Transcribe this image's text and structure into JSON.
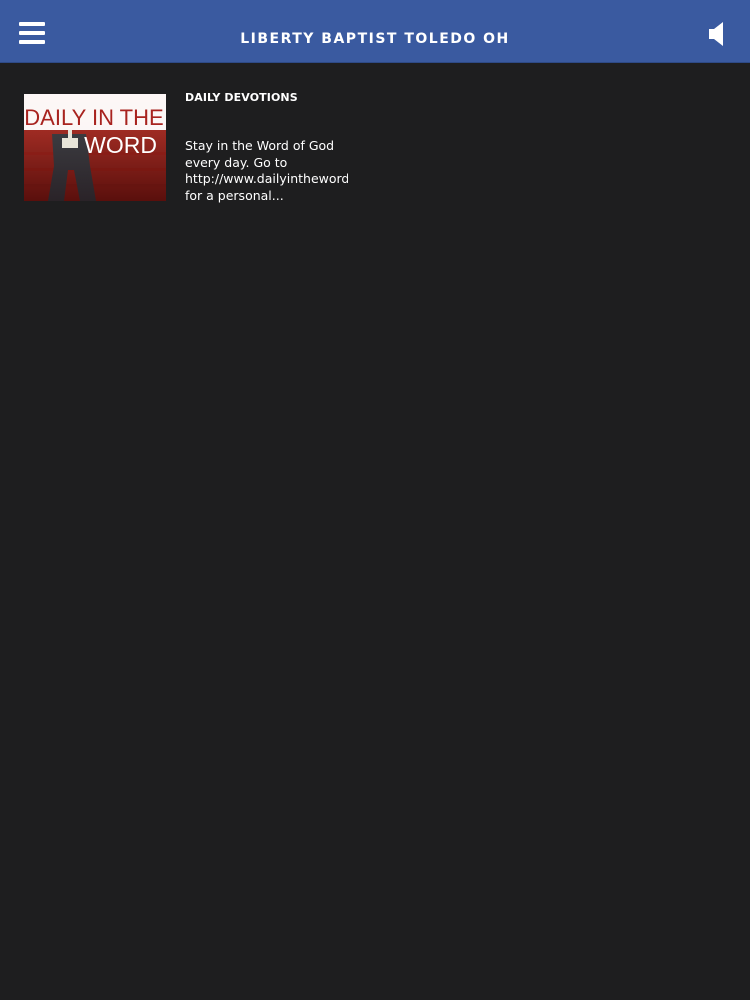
{
  "header": {
    "title": "LIBERTY BAPTIST TOLEDO OH",
    "menu_icon": "hamburger-menu-icon",
    "audio_icon": "speaker-icon",
    "bar_color": "#3a5aa0"
  },
  "list": {
    "items": [
      {
        "thumbnail_text": [
          "DAILY IN THE",
          "WORD"
        ],
        "title": "DAILY DEVOTIONS",
        "description_lines": [
          "Stay in the Word of God",
          "every day. Go to",
          "http://www.dailyintheword",
          "for a personal..."
        ]
      }
    ]
  },
  "colors": {
    "background": "#1e1e1f",
    "thumbnail_red": "#b32424"
  }
}
